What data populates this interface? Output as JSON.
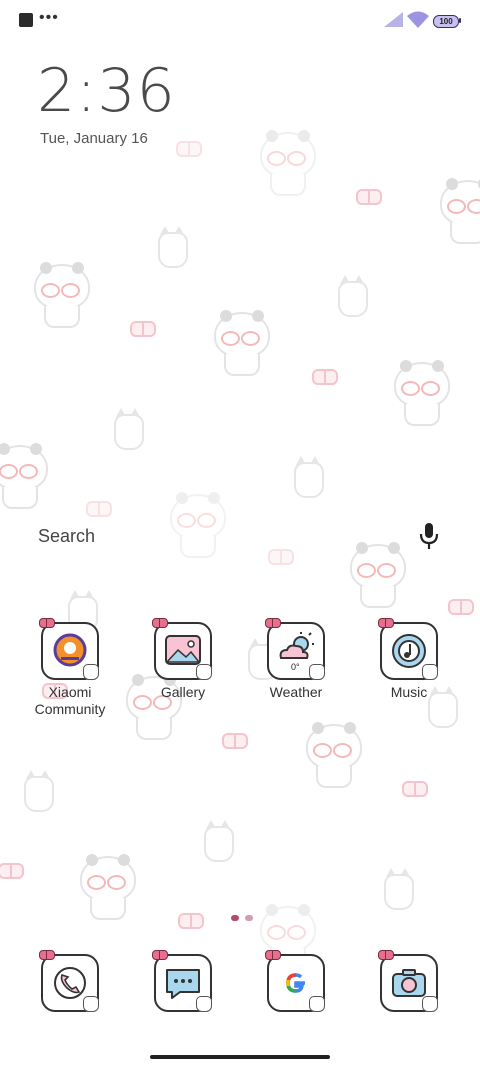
{
  "status_bar": {
    "notification_icons": [
      "square-icon",
      "more-dots-icon"
    ],
    "battery_level": "100",
    "signal_icon": "cellular-signal-icon",
    "wifi_icon": "wifi-icon"
  },
  "lock_clock": {
    "time": "2:36",
    "date": "Tue, January 16"
  },
  "search": {
    "label": "Search",
    "mic_icon": "microphone-icon"
  },
  "apps": [
    {
      "label": "Xiaomi\nCommunity",
      "icon": "xiaomi-community-icon"
    },
    {
      "label": "Gallery",
      "icon": "gallery-icon"
    },
    {
      "label": "Weather",
      "icon": "weather-icon",
      "badge": "0°"
    },
    {
      "label": "Music",
      "icon": "music-icon"
    }
  ],
  "dock": [
    {
      "icon": "phone-icon"
    },
    {
      "icon": "messages-icon"
    },
    {
      "icon": "google-icon"
    },
    {
      "icon": "camera-icon"
    }
  ],
  "colors": {
    "accent": "#e56f8f",
    "icon_fill": "#a9d7ee",
    "icon_stroke": "#333333"
  }
}
